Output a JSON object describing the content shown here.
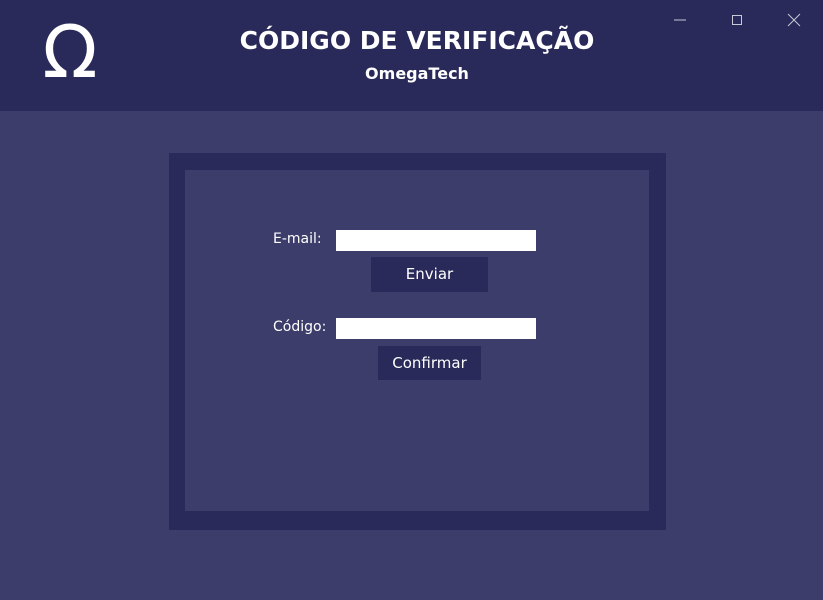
{
  "header": {
    "logo_glyph": "Ω",
    "title": "CÓDIGO DE VERIFICAÇÃO",
    "subtitle": "OmegaTech"
  },
  "window_controls": {
    "minimize_icon": "minimize-icon",
    "maximize_icon": "maximize-icon",
    "close_icon": "close-icon"
  },
  "form": {
    "email_label": "E-mail:",
    "email_value": "",
    "send_button": "Enviar",
    "code_label": "Código:",
    "code_value": "",
    "confirm_button": "Confirmar"
  },
  "colors": {
    "header_bg": "#29295a",
    "body_bg": "#3d3d6b",
    "frame_bg": "#29295a",
    "button_bg": "#29295a",
    "text": "#ffffff"
  }
}
